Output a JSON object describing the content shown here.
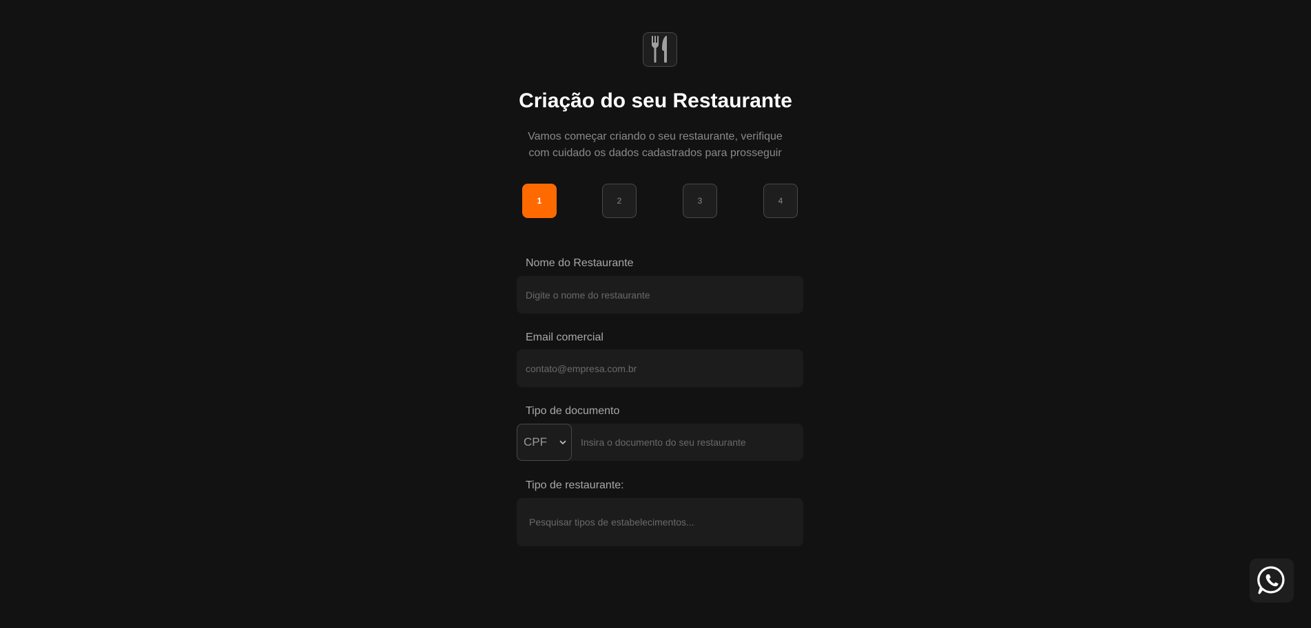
{
  "header": {
    "logo_icon": "fork-knife-icon",
    "title": "Criação do seu Restaurante",
    "subtitle": "Vamos começar criando o seu restaurante, verifique com cuidado os dados cadastrados para prosseguir"
  },
  "steps": {
    "current": 1,
    "items": [
      {
        "label": "1"
      },
      {
        "label": "2"
      },
      {
        "label": "3"
      },
      {
        "label": "4"
      }
    ]
  },
  "form": {
    "restaurant_name": {
      "label": "Nome do Restaurante",
      "placeholder": "Digite o nome do restaurante",
      "value": ""
    },
    "email": {
      "label": "Email comercial",
      "placeholder": "contato@empresa.com.br",
      "value": ""
    },
    "document": {
      "label": "Tipo de documento",
      "selected_type": "CPF",
      "placeholder": "Insira o documento do seu restaurante",
      "value": ""
    },
    "restaurant_type": {
      "label": "Tipo de restaurante:",
      "placeholder": "Pesquisar tipos de estabelecimentos...",
      "value": ""
    }
  },
  "floating": {
    "whatsapp_icon": "whatsapp-icon"
  },
  "colors": {
    "accent": "#ff6a00",
    "background": "#121212",
    "surface": "#1c1c1c"
  }
}
